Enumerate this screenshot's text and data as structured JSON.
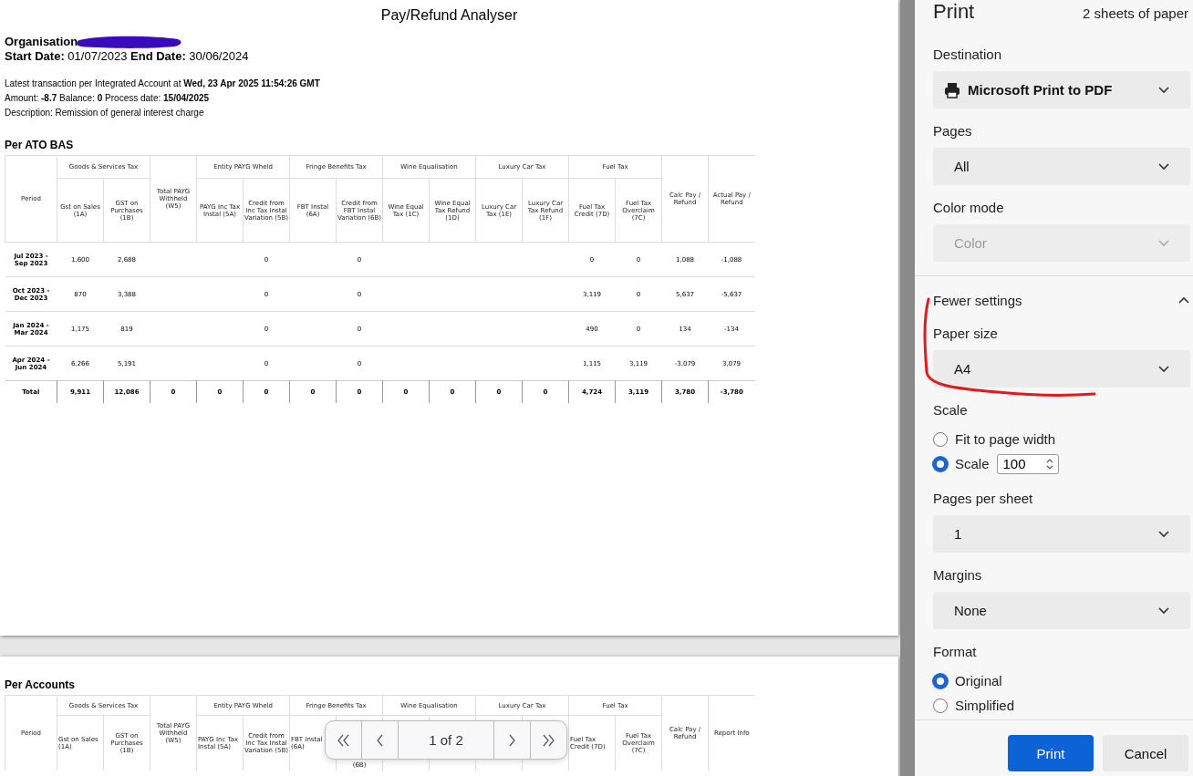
{
  "report": {
    "title": "Pay/Refund Analyser",
    "organisation_label": "Organisation",
    "dates": "**Start Date:** 01/07/2023 **End Date:** 30/06/2024",
    "info_lines": [
      "Latest transaction per Integrated Account at **Wed, 23 Apr 2025 11:54:26 GMT**",
      "Amount: **-8.7** Balance: **0** Process date: **15/04/2025**",
      "Description: Remission of general interest charge"
    ]
  },
  "sections": [
    {
      "title": "Per ATO BAS",
      "header_groups": [
        {
          "columns": [
            "Period"
          ]
        },
        {
          "label": "Goods & Services Tax",
          "columns": [
            "Gst on Sales (1A)",
            "GST on Purchases (1B)"
          ]
        },
        {
          "columns": [
            "Total PAYG Withheld (W5)"
          ]
        },
        {
          "label": "Entity PAYG Wheld",
          "columns": [
            "PAYG Inc Tax Instal (5A)",
            "Credit from Inc Tax Instal Variation (5B)"
          ]
        },
        {
          "label": "Fringe Benefits Tax",
          "columns": [
            "FBT Instal (6A)",
            "Credit from FBT Instal Variation (6B)"
          ]
        },
        {
          "label": "Wine Equalisation",
          "columns": [
            "Wine Equal Tax (1C)",
            "Wine Equal Tax Refund (1D)"
          ]
        },
        {
          "label": "Luxury Car Tax",
          "columns": [
            "Luxury Car Tax (1E)",
            "Luxury Car Tax Refund (1F)"
          ]
        },
        {
          "label": "Fuel Tax",
          "columns": [
            "Fuel Tax Credit (7D)",
            "Fuel Tax Overclaim (7C)"
          ]
        },
        {
          "columns": [
            "Calc Pay / Refund"
          ]
        },
        {
          "columns": [
            "Actual Pay / Refund"
          ]
        }
      ],
      "rows": [
        {
          "period": "Jul 2023 - Sep 2023",
          "cells": [
            "1,600",
            "2,688",
            null,
            null,
            "0",
            null,
            "0",
            null,
            null,
            null,
            null,
            "0",
            "0",
            "1,088",
            "-1,088"
          ]
        },
        {
          "period": "Oct 2023 - Dec 2023",
          "cells": [
            "870",
            "3,388",
            null,
            null,
            "0",
            null,
            "0",
            null,
            null,
            null,
            null,
            "3,119",
            "0",
            "5,637",
            "-5,637"
          ]
        },
        {
          "period": "Jan 2024 - Mar 2024",
          "cells": [
            "1,175",
            "819",
            null,
            null,
            "0",
            null,
            "0",
            null,
            null,
            null,
            null,
            "490",
            "0",
            "134",
            "-134"
          ]
        },
        {
          "period": "Apr 2024 - Jun 2024",
          "cells": [
            "6,266",
            "5,191",
            null,
            null,
            "0",
            null,
            "0",
            null,
            null,
            null,
            null,
            "1,115",
            "3,119",
            "-3,079",
            "3,079"
          ]
        }
      ],
      "total": {
        "period": "Total",
        "cells": [
          "9,911",
          "12,086",
          "0",
          "0",
          "0",
          "0",
          "0",
          "0",
          "0",
          "0",
          "0",
          "4,724",
          "3,119",
          "3,780",
          "-3,780"
        ]
      }
    },
    {
      "title": "Per Accounts",
      "header_groups": [
        {
          "columns": [
            "Period"
          ]
        },
        {
          "label": "Goods & Services Tax",
          "columns": [
            "Gst on Sales (1A)",
            "GST on Purchases (1B)"
          ]
        },
        {
          "columns": [
            "Total PAYG Withheld (W5)"
          ]
        },
        {
          "label": "Entity PAYG Wheld",
          "columns": [
            "PAYG Inc Tax Instal (5A)",
            "Credit from Inc Tax Instal Variation (5B)"
          ]
        },
        {
          "label": "Fringe Benefits Tax",
          "columns": [
            "FBT Instal (6A)",
            {
              "text": "(6B)",
              "kind": "fragment"
            }
          ]
        },
        {
          "label": "Wine Equalisation",
          "columns": [
            null,
            null
          ]
        },
        {
          "label": "Luxury Car Tax",
          "columns": [
            null,
            null
          ]
        },
        {
          "label": "Fuel Tax",
          "columns": [
            "Fuel Tax Credit (7D)",
            "Fuel Tax Overclaim (7C)"
          ]
        },
        {
          "columns": [
            "Calc Pay / Refund"
          ]
        },
        {
          "columns": [
            "Report Info"
          ]
        }
      ]
    }
  ],
  "pager": {
    "text": "1 of 2"
  },
  "print_panel": {
    "title": "Print",
    "sheets": "2 sheets of paper",
    "settings": [
      {
        "kind": "destination",
        "label": "Destination",
        "value": "Microsoft Print to PDF"
      },
      {
        "kind": "select",
        "label": "Pages",
        "value": "All",
        "disabled": false
      },
      {
        "kind": "select",
        "label": "Color mode",
        "value": "Color",
        "disabled": true
      },
      {
        "kind": "toggle",
        "label": "Fewer settings",
        "expanded": true
      },
      {
        "kind": "select",
        "label": "Paper size",
        "value": "A4",
        "disabled": false
      },
      {
        "kind": "radios",
        "label": "Scale",
        "options": [
          {
            "label": "Fit to page width",
            "selected": false
          },
          {
            "label": "Scale",
            "selected": true,
            "value": "100"
          }
        ]
      },
      {
        "kind": "select",
        "label": "Pages per sheet",
        "value": "1",
        "disabled": false
      },
      {
        "kind": "select",
        "label": "Margins",
        "value": "None",
        "disabled": false
      },
      {
        "kind": "radios",
        "label": "Format",
        "options": [
          {
            "label": "Original",
            "selected": true
          },
          {
            "label": "Simplified",
            "selected": false
          }
        ]
      }
    ],
    "buttons": [
      {
        "label": "Print",
        "primary": true
      },
      {
        "label": "Cancel",
        "primary": false
      }
    ]
  }
}
